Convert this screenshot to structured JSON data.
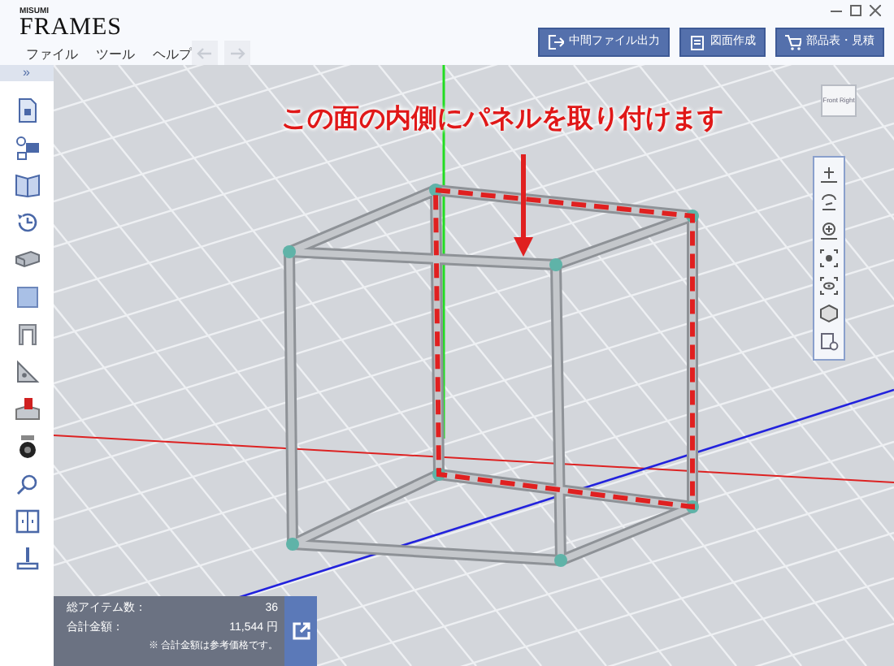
{
  "window": {
    "brand": "MISUMI",
    "logo": "FRAMES"
  },
  "menu": [
    "ファイル",
    "ツール",
    "ヘルプ"
  ],
  "history": [
    {
      "kind": "undo",
      "disabled": true
    },
    {
      "kind": "redo",
      "disabled": true
    }
  ],
  "toolbar_buttons": [
    {
      "kind": "export",
      "label": "中間ファイル出力"
    },
    {
      "kind": "drawing",
      "label": "図面作成"
    },
    {
      "kind": "cart",
      "label": "部品表・見積"
    }
  ],
  "panel_toggle": "»",
  "annotation": "この面の内側にパネルを取り付けます",
  "view_cube": {
    "faces": [
      "Front",
      "Right"
    ]
  },
  "summary": {
    "rows": [
      {
        "label": "総アイテム数：",
        "value": "36"
      },
      {
        "label": "合計金額：",
        "value": "11,544 円"
      }
    ],
    "note": "※ 合計金額は参考価格です。"
  }
}
